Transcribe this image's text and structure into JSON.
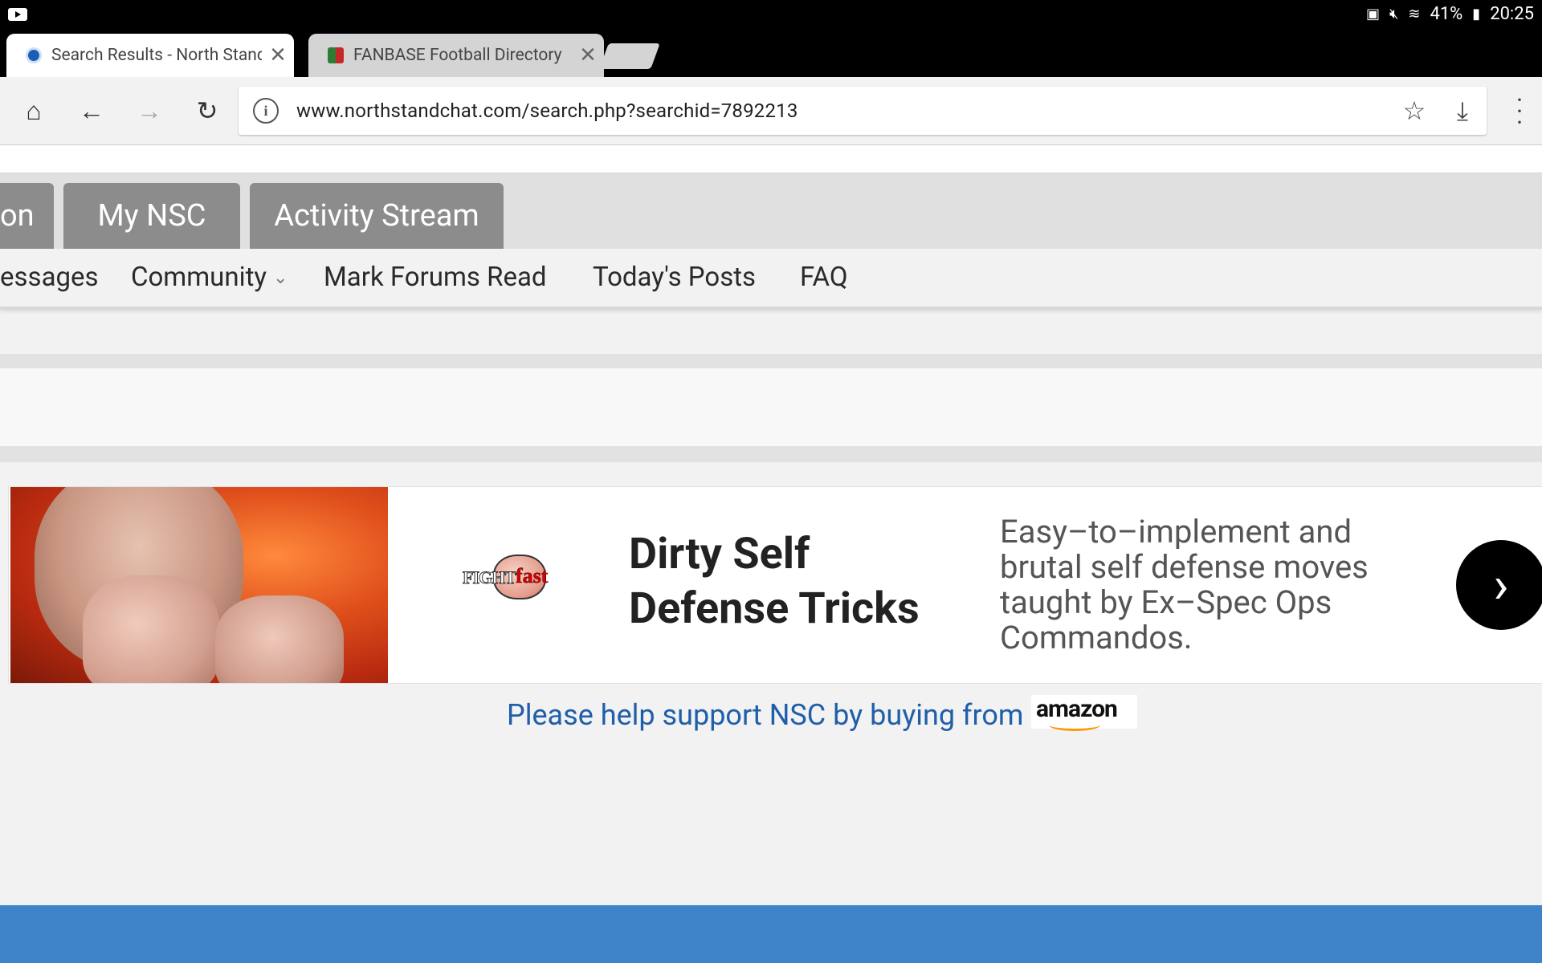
{
  "status_bar": {
    "battery": "41%",
    "time": "20:25"
  },
  "tabs": [
    {
      "title": "Search Results - North Stand Chat",
      "active": true
    },
    {
      "title": "FANBASE Football Directory",
      "active": false
    }
  ],
  "toolbar": {
    "url": "www.northstandchat.com/search.php?searchid=7892213"
  },
  "nav": {
    "tabs": [
      "on",
      "My NSC",
      "Activity Stream"
    ],
    "subnav": [
      "essages",
      "Community",
      "Mark Forums Read",
      "Today's Posts",
      "FAQ"
    ]
  },
  "ad": {
    "logo_text_1": "FIGHT",
    "logo_text_2": "fast",
    "headline": "Dirty Self Defense Tricks",
    "description": "Easy–to–implement and brutal self defense moves taught by Ex–Spec Ops Commandos."
  },
  "support": {
    "text": "Please help support NSC by buying from",
    "brand": "amazon"
  },
  "colors": {
    "footer": "#3f84c8",
    "link": "#1f5ea8",
    "nav_tab": "#8c8c8c"
  }
}
